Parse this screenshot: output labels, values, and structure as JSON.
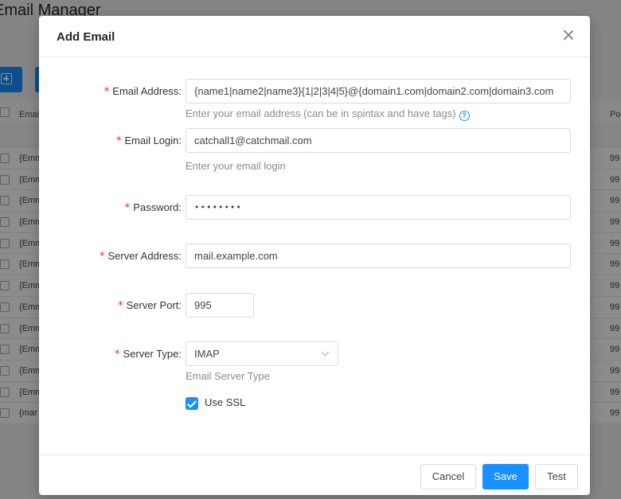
{
  "background": {
    "page_title": "Email Manager",
    "table_header_left": "Emai",
    "table_header_right": "Po",
    "rows": [
      {
        "left": "{Emm",
        "right": "99"
      },
      {
        "left": "{Emm",
        "right": "99"
      },
      {
        "left": "{Emm",
        "right": "99"
      },
      {
        "left": "{Emm",
        "right": "99"
      },
      {
        "left": "{Emm",
        "right": "99"
      },
      {
        "left": "{Emm",
        "right": "99"
      },
      {
        "left": "{Emm",
        "right": "99"
      },
      {
        "left": "{Emm",
        "right": "99"
      },
      {
        "left": "{Emm",
        "right": "99"
      },
      {
        "left": "{Emm",
        "right": "99"
      },
      {
        "left": "{Emm",
        "right": "99"
      },
      {
        "left": "{Emm",
        "right": "99"
      },
      {
        "left": "{mar",
        "right": "99"
      }
    ]
  },
  "modal": {
    "title": "Add Email",
    "close_icon": "close-icon",
    "fields": {
      "email_address": {
        "label": "Email Address:",
        "value": "{name1|name2|name3}{1|2|3|4|5}@{domain1.com|domain2.com|domain3.com",
        "help": "Enter your email address (can be in spintax and have tags)",
        "help_icon": "question-circle-icon"
      },
      "email_login": {
        "label": "Email Login:",
        "value": "catchall1@catchmail.com",
        "help": "Enter your email login"
      },
      "password": {
        "label": "Password:",
        "value": "••••••••"
      },
      "server_address": {
        "label": "Server Address:",
        "value": "mail.example.com"
      },
      "server_port": {
        "label": "Server Port:",
        "value": "995"
      },
      "server_type": {
        "label": "Server Type:",
        "value": "IMAP",
        "help": "Email Server Type"
      },
      "use_ssl": {
        "label": "Use SSL",
        "checked": true
      }
    },
    "required_marker": "*",
    "buttons": {
      "cancel": "Cancel",
      "save": "Save",
      "test": "Test"
    }
  },
  "colors": {
    "primary": "#1890ff",
    "required": "#f5222d"
  }
}
